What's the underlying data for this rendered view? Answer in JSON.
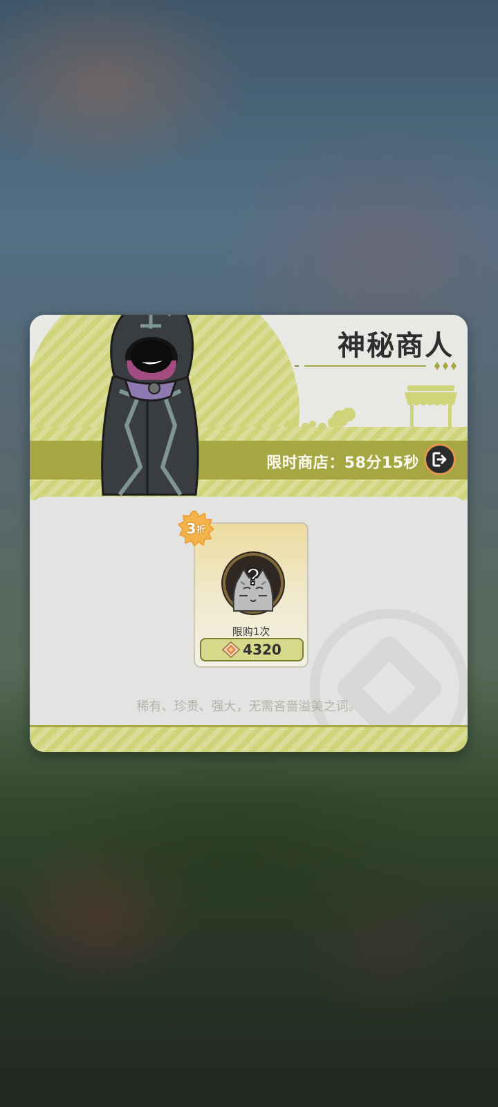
{
  "shop": {
    "title": "神秘商人",
    "timer_label": "限时商店：58分15秒",
    "description": "稀有、珍贵、强大，无需吝啬溢美之词。"
  },
  "item": {
    "discount_number": "3",
    "discount_unit": "折",
    "portrait_mark": "?",
    "limit_label": "限购1次",
    "price": "4320",
    "currency_icon": "diamond-gem-icon"
  },
  "colors": {
    "accent_olive": "#a6a742",
    "accent_lime": "#cfd47a",
    "badge_orange": "#f3b34a",
    "exit_ring": "#e39a4e"
  }
}
